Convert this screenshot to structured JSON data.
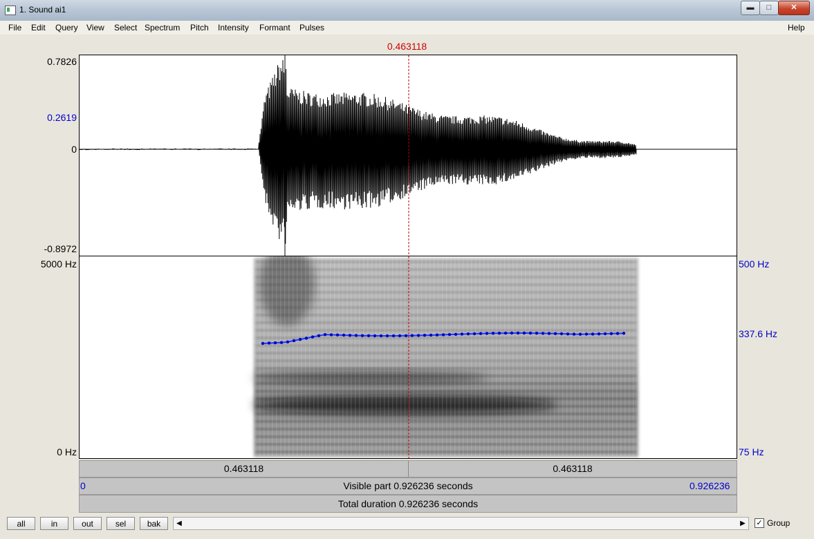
{
  "window": {
    "title": "1. Sound ai1"
  },
  "menu": [
    "File",
    "Edit",
    "Query",
    "View",
    "Select",
    "Spectrum",
    "Pitch",
    "Intensity",
    "Formant",
    "Pulses"
  ],
  "help_label": "Help",
  "cursor_time": "0.463118",
  "waveform": {
    "max_label": "0.7826",
    "mid_label": "0.2619",
    "zero_label": "0",
    "min_label": "-0.8972"
  },
  "spectrogram": {
    "max_label": "5000 Hz",
    "min_label": "0 Hz"
  },
  "pitch_axis": {
    "max_label": "500 Hz",
    "value_label": "337.6 Hz",
    "min_label": "75 Hz"
  },
  "time_bars": {
    "left_segment": "0.463118",
    "right_segment": "0.463118",
    "visible_start": "0",
    "visible_label": "Visible part 0.926236 seconds",
    "visible_end": "0.926236",
    "total_label": "Total duration 0.926236 seconds"
  },
  "buttons": [
    "all",
    "in",
    "out",
    "sel",
    "bak"
  ],
  "group": {
    "label": "Group",
    "checked": true
  },
  "colors": {
    "cursor": "#d00000",
    "pitch": "#0000c8",
    "axis_blue": "#0000c8"
  }
}
